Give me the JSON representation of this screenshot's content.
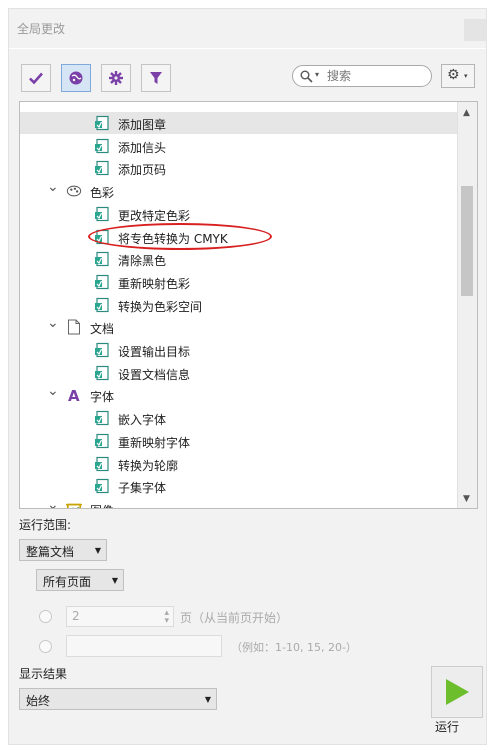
{
  "window": {
    "title": "全局更改"
  },
  "toolbar": {
    "buttons": [
      {
        "name": "checkmark",
        "icon": "check-icon",
        "color": "#7b3fa8"
      },
      {
        "name": "globe",
        "icon": "globe-icon",
        "color": "#7b3fa8",
        "selected": true
      },
      {
        "name": "settings",
        "icon": "gear-icon",
        "color": "#7b3fa8"
      },
      {
        "name": "filter",
        "icon": "funnel-icon",
        "color": "#7b3fa8"
      }
    ],
    "search_placeholder": "搜索",
    "options_icon": "gear-dropdown-icon"
  },
  "tree": {
    "items": [
      {
        "label": "添加图章",
        "level": 2,
        "icon": "action-icon",
        "highlighted": true
      },
      {
        "label": "添加信头",
        "level": 2,
        "icon": "action-icon"
      },
      {
        "label": "添加页码",
        "level": 2,
        "icon": "action-icon"
      },
      {
        "label": "色彩",
        "level": 1,
        "icon": "palette-icon",
        "expanded": true
      },
      {
        "label": "更改特定色彩",
        "level": 2,
        "icon": "action-icon"
      },
      {
        "label": "将专色转换为 CMYK",
        "level": 2,
        "icon": "action-icon",
        "circled": true
      },
      {
        "label": "清除黑色",
        "level": 2,
        "icon": "action-icon"
      },
      {
        "label": "重新映射色彩",
        "level": 2,
        "icon": "action-icon"
      },
      {
        "label": "转换为色彩空间",
        "level": 2,
        "icon": "action-icon"
      },
      {
        "label": "文档",
        "level": 1,
        "icon": "document-icon",
        "expanded": true
      },
      {
        "label": "设置输出目标",
        "level": 2,
        "icon": "action-icon"
      },
      {
        "label": "设置文档信息",
        "level": 2,
        "icon": "action-icon"
      },
      {
        "label": "字体",
        "level": 1,
        "icon": "font-icon",
        "expanded": true
      },
      {
        "label": "嵌入字体",
        "level": 2,
        "icon": "action-icon"
      },
      {
        "label": "重新映射字体",
        "level": 2,
        "icon": "action-icon"
      },
      {
        "label": "转换为轮廓",
        "level": 2,
        "icon": "action-icon"
      },
      {
        "label": "子集字体",
        "level": 2,
        "icon": "action-icon"
      },
      {
        "label": "图像",
        "level": 1,
        "icon": "image-icon",
        "expanded": true
      }
    ]
  },
  "run_scope": {
    "label": "运行范围:",
    "scope_value": "整篇文档",
    "pages_value": "所有页面",
    "start_page_value": "2",
    "start_page_suffix": "页（从当前页开始）",
    "range_placeholder": "",
    "range_example": "（例如：1-10, 15, 20-）"
  },
  "show_results": {
    "label": "显示结果",
    "value": "始终"
  },
  "run": {
    "label": "运行",
    "color": "#6cbe2c"
  }
}
